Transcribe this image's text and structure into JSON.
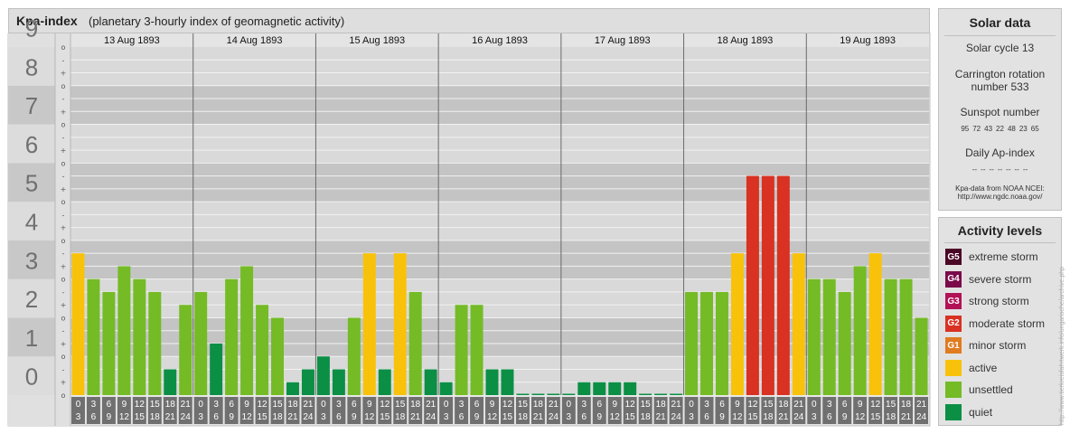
{
  "header": {
    "title": "Kpa-index",
    "subtitle": "(planetary 3-hourly index of geomagnetic activity)"
  },
  "chart_data": {
    "type": "bar",
    "ylim": [
      0,
      9
    ],
    "y_major_ticks": [
      "0",
      "1",
      "2",
      "3",
      "4",
      "5",
      "6",
      "7",
      "8",
      "9"
    ],
    "y_minor_marks": [
      "o",
      "+",
      "-"
    ],
    "days": [
      "13 Aug 1893",
      "14 Aug 1893",
      "15 Aug 1893",
      "16 Aug 1893",
      "17 Aug 1893",
      "18 Aug 1893",
      "19 Aug 1893"
    ],
    "interval_start_labels": [
      "0",
      "3",
      "6",
      "9",
      "12",
      "15",
      "18",
      "21"
    ],
    "interval_end_labels": [
      "3",
      "6",
      "9",
      "12",
      "15",
      "18",
      "21",
      "24"
    ],
    "values": [
      3.667,
      3.0,
      2.667,
      3.333,
      3.0,
      2.667,
      0.667,
      2.333,
      2.667,
      1.333,
      3.0,
      3.333,
      2.333,
      2.0,
      0.333,
      0.667,
      1.0,
      0.667,
      2.0,
      3.667,
      0.667,
      3.667,
      2.667,
      0.667,
      0.333,
      2.333,
      2.333,
      0.667,
      0.667,
      0.0,
      0.0,
      0.0,
      0.0,
      0.333,
      0.333,
      0.333,
      0.333,
      0.0,
      0.0,
      0.0,
      2.667,
      2.667,
      2.667,
      3.667,
      5.667,
      5.667,
      5.667,
      3.667,
      3.0,
      3.0,
      2.667,
      3.333,
      3.667,
      3.0,
      3.0,
      2.0
    ],
    "colors": {
      "quiet": "#0b8f45",
      "unsettled": "#74bb26",
      "active": "#f9c20a",
      "minor_storm": "#e07b20",
      "moderate_storm": "#d93122",
      "strong_storm": "#b31256",
      "severe_storm": "#7a0a4a",
      "extreme_storm": "#4a0626"
    }
  },
  "solar_data": {
    "title": "Solar data",
    "solar_cycle": "Solar cycle 13",
    "carrington_line1": "Carrington rotation",
    "carrington_line2": "number 533",
    "sunspot_title": "Sunspot number",
    "sunspot_numbers": [
      "95",
      "72",
      "43",
      "22",
      "48",
      "23",
      "65"
    ],
    "ap_title": "Daily Ap-index",
    "ap_values": [
      "--",
      "--",
      "--",
      "--",
      "--",
      "--",
      "--"
    ],
    "source_line1": "Kpa-data from NOAA NCEI:",
    "source_line2": "http://www.ngdc.noaa.gov/"
  },
  "activity_levels": {
    "title": "Activity levels",
    "items": [
      {
        "code": "G5",
        "label": "extreme storm",
        "color": "#4a0626"
      },
      {
        "code": "G4",
        "label": "severe storm",
        "color": "#7a0a4a"
      },
      {
        "code": "G3",
        "label": "strong storm",
        "color": "#b31256"
      },
      {
        "code": "G2",
        "label": "moderate storm",
        "color": "#d93122"
      },
      {
        "code": "G1",
        "label": "minor storm",
        "color": "#e07b20"
      },
      {
        "code": "",
        "label": "active",
        "color": "#f9c20a"
      },
      {
        "code": "",
        "label": "unsettled",
        "color": "#74bb26"
      },
      {
        "code": "",
        "label": "quiet",
        "color": "#0b8f45"
      }
    ]
  },
  "watermark": "http://www.tierkreisfahrtwerk.info/ungarische/archive.php"
}
